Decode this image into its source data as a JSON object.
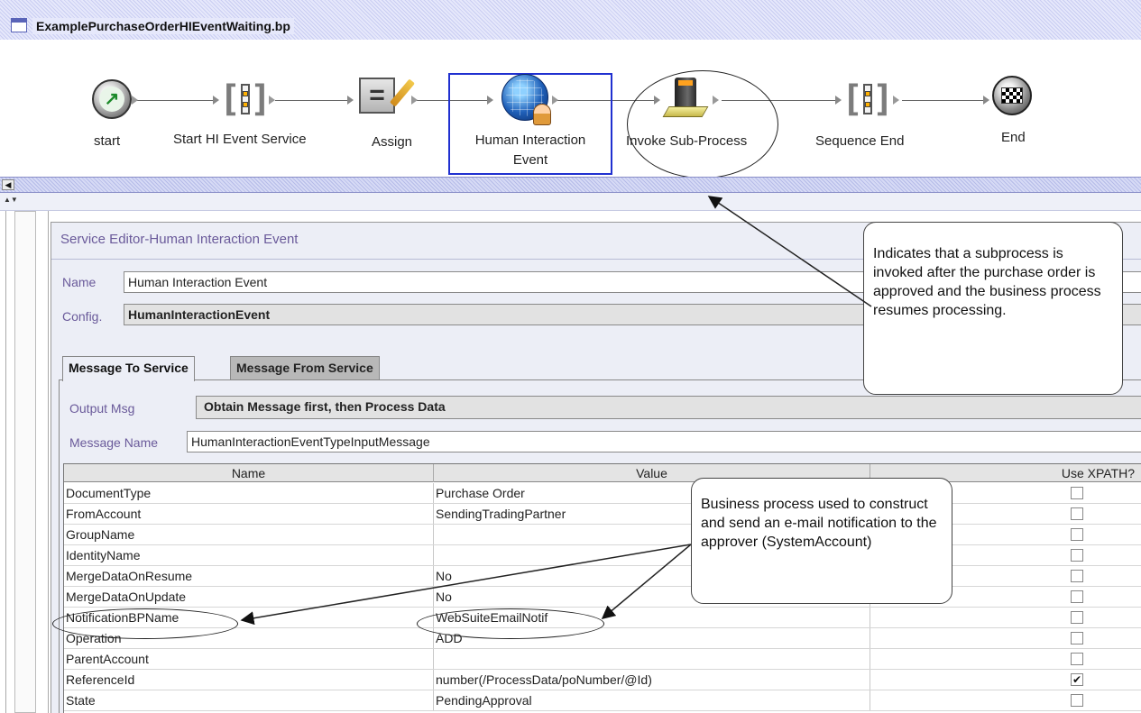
{
  "window": {
    "title": "ExamplePurchaseOrderHIEventWaiting.bp",
    "icon": "window-icon"
  },
  "process_nodes": [
    {
      "label": "start",
      "icon": "start-run-icon"
    },
    {
      "label": "Start HI Event Service",
      "icon": "sequence-bracket-icon"
    },
    {
      "label": "Assign",
      "icon": "assign-pencil-icon"
    },
    {
      "label": "Human Interaction",
      "label2": "Event",
      "icon": "globe-person-icon"
    },
    {
      "label": "Invoke Sub-Process",
      "icon": "computer-tower-icon"
    },
    {
      "label": "Sequence End",
      "icon": "sequence-bracket-icon"
    },
    {
      "label": "End",
      "icon": "checkered-flag-icon"
    }
  ],
  "editor": {
    "title": "Service Editor-Human Interaction Event",
    "name_label": "Name",
    "name_value": "Human Interaction Event",
    "config_label": "Config.",
    "config_value": "HumanInteractionEvent",
    "tabs": [
      "Message To Service",
      "Message From Service"
    ],
    "output_msg_label": "Output Msg",
    "output_msg_value": "Obtain Message first, then Process Data",
    "message_name_label": "Message Name",
    "message_name_value": "HumanInteractionEventTypeInputMessage"
  },
  "grid": {
    "columns": [
      "Name",
      "Value",
      "Use XPATH?"
    ],
    "rows": [
      {
        "name": "DocumentType",
        "value": "Purchase Order",
        "xpath": false
      },
      {
        "name": "FromAccount",
        "value": "SendingTradingPartner",
        "xpath": false
      },
      {
        "name": "GroupName",
        "value": "",
        "xpath": false
      },
      {
        "name": "IdentityName",
        "value": "",
        "xpath": false
      },
      {
        "name": "MergeDataOnResume",
        "value": "No",
        "xpath": false
      },
      {
        "name": "MergeDataOnUpdate",
        "value": "No",
        "xpath": false
      },
      {
        "name": "NotificationBPName",
        "value": "WebSuiteEmailNotif",
        "xpath": false
      },
      {
        "name": "Operation",
        "value": "ADD",
        "xpath": false
      },
      {
        "name": "ParentAccount",
        "value": "",
        "xpath": false
      },
      {
        "name": "ReferenceId",
        "value": "number(/ProcessData/poNumber/@Id)",
        "xpath": true
      },
      {
        "name": "State",
        "value": "PendingApproval",
        "xpath": false
      }
    ]
  },
  "callouts": {
    "subprocess": "Indicates that a subprocess is invoked after the purchase order is approved and the business process resumes processing.",
    "email": "Business process used to construct and send an e-mail notification to the approver (SystemAccount)"
  },
  "colors": {
    "selection": "#2030d0",
    "label_purple": "#6a5a9a",
    "panel_bg": "#eceef6"
  }
}
